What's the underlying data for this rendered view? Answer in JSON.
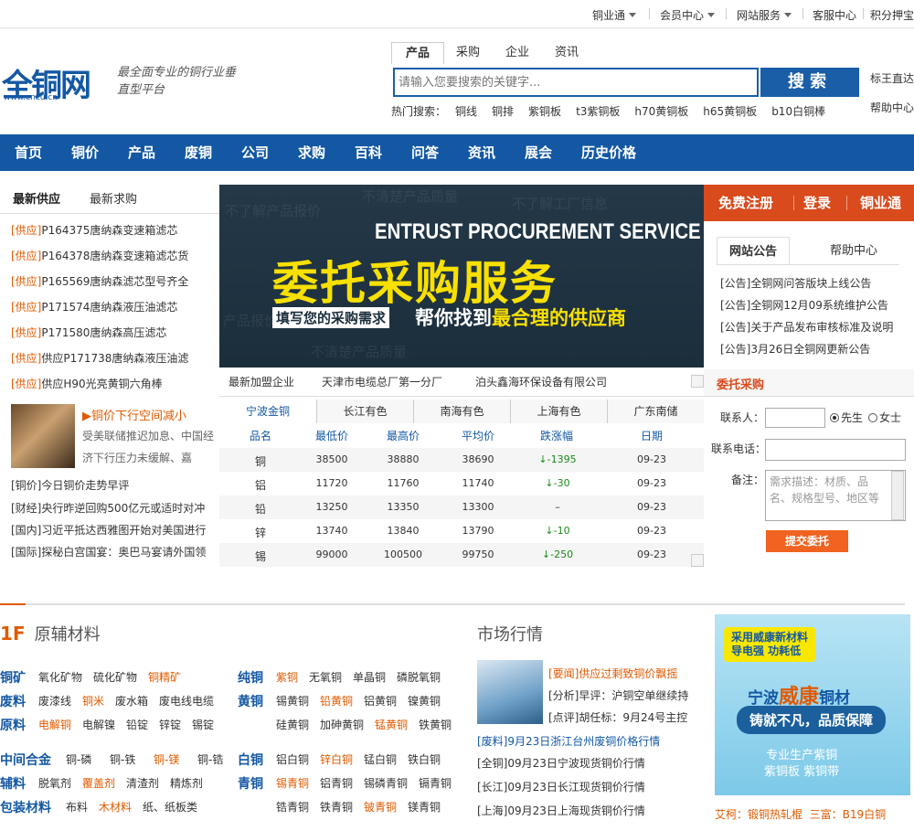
{
  "topbar": {
    "items": [
      {
        "label": "铜业通",
        "dropdown": true
      },
      {
        "label": "会员中心",
        "dropdown": true
      },
      {
        "label": "网站服务",
        "dropdown": true
      },
      {
        "label": "客服中心",
        "dropdown": false
      },
      {
        "label": "积分押宝",
        "dropdown": false
      }
    ]
  },
  "header": {
    "logo_text": "全铜网",
    "logo_url": "www.cncu.cn",
    "slogan": "最全面专业的铜行业垂直型平台",
    "search_tabs": [
      "产品",
      "采购",
      "企业",
      "资讯"
    ],
    "search_placeholder": "请输入您要搜索的关键字...",
    "search_button": "搜索",
    "hot_label": "热门搜索：",
    "hot_terms": [
      "铜线",
      "铜排",
      "紫铜板",
      "t3紫铜板",
      "h70黄铜板",
      "h65黄铜板",
      "b10白铜棒"
    ],
    "right_links": [
      "标王直达",
      "帮助中心"
    ]
  },
  "nav": [
    "首页",
    "铜价",
    "产品",
    "废铜",
    "公司",
    "求购",
    "百科",
    "问答",
    "资讯",
    "展会",
    "历史价格"
  ],
  "supply": {
    "tabs": [
      "最新供应",
      "最新求购"
    ],
    "items": [
      {
        "tag": "[供应]",
        "text": "P164375唐纳森变速箱滤芯"
      },
      {
        "tag": "[供应]",
        "text": "P164378唐纳森变速箱滤芯货"
      },
      {
        "tag": "[供应]",
        "text": "P165569唐纳森滤芯型号齐全"
      },
      {
        "tag": "[供应]",
        "text": "P171574唐纳森液压油滤芯"
      },
      {
        "tag": "[供应]",
        "text": "P171580唐纳森高压滤芯"
      },
      {
        "tag": "[供应]",
        "text": "供应P171738唐纳森液压油滤"
      },
      {
        "tag": "[供应]",
        "text": "供应H90光亮黄铜六角棒"
      }
    ]
  },
  "news": {
    "headline": "▶铜价下行空间减小",
    "summary_1": "受美联储推迟加息、中国经",
    "summary_2": "济下行压力未缓解、嘉",
    "items": [
      "[铜价]今日铜价走势早评",
      "[财经]央行昨逆回购500亿元或适时对冲",
      "[国内]习近平抵达西雅图开始对美国进行",
      "[国际]探秘白宫国宴：奥巴马宴请外国领"
    ]
  },
  "banner": {
    "en_title": "ENTRUST PROCUREMENT SERVICE",
    "cn_title": "委托采购服务",
    "sub_box": "填写您的采购需求",
    "sub_text_a": "帮你找到",
    "sub_text_b": "最合理的供应商",
    "watermarks": [
      "不了解产品报价",
      "不清楚产品质量",
      "不了解工厂信息",
      "产品报价",
      "不清楚产品质量"
    ]
  },
  "new_members": {
    "label": "最新加盟企业",
    "companies": [
      "天津市电缆总厂第一分厂",
      "泊头鑫海环保设备有限公司"
    ]
  },
  "prices": {
    "tabs": [
      "宁波金铜",
      "长江有色",
      "南海有色",
      "上海有色",
      "广东南储"
    ],
    "headers": [
      "品名",
      "最低价",
      "最高价",
      "平均价",
      "跌涨幅",
      "日期"
    ],
    "rows": [
      {
        "name": "铜",
        "low": "38500",
        "high": "38880",
        "avg": "38690",
        "change": "↓-1395",
        "date": "09-23"
      },
      {
        "name": "铝",
        "low": "11720",
        "high": "11760",
        "avg": "11740",
        "change": "↓-30",
        "date": "09-23"
      },
      {
        "name": "铅",
        "low": "13250",
        "high": "13350",
        "avg": "13300",
        "change": "–",
        "date": "09-23"
      },
      {
        "name": "锌",
        "low": "13740",
        "high": "13840",
        "avg": "13790",
        "change": "↓-10",
        "date": "09-23"
      },
      {
        "name": "锡",
        "low": "99000",
        "high": "100500",
        "avg": "99750",
        "change": "↓-250",
        "date": "09-23"
      }
    ]
  },
  "auth": [
    "免费注册",
    "登录",
    "铜业通"
  ],
  "notice": {
    "tabs": [
      "网站公告",
      "帮助中心"
    ],
    "items": [
      "[公告]全铜网问答版块上线公告",
      "[公告]全铜网12月09系统维护公告",
      "[公告]关于产品发布审核标准及说明",
      "[公告]3月26日全铜网更新公告"
    ]
  },
  "entrust": {
    "title": "委托采购",
    "contact_label": "联系人：",
    "gender_male": "先生",
    "gender_female": "女士",
    "phone_label": "联系电话：",
    "note_label": "备注：",
    "note_placeholder": "需求描述：材质、品名、规格型号、地区等",
    "submit": "提交委托"
  },
  "floor": {
    "num": "1F",
    "title": "原辅材料",
    "groups": [
      {
        "cat": "铜矿",
        "items": [
          {
            "t": "氧化矿物",
            "hl": false
          },
          {
            "t": "硫化矿物",
            "hl": false
          },
          {
            "t": "铜精矿",
            "hl": true
          }
        ]
      },
      {
        "cat": "废料",
        "items": [
          {
            "t": "废漆线",
            "hl": false
          },
          {
            "t": "铜米",
            "hl": true
          },
          {
            "t": "废水箱",
            "hl": false
          },
          {
            "t": "废电线电缆",
            "hl": false
          }
        ]
      },
      {
        "cat": "原料",
        "items": [
          {
            "t": "电解铜",
            "hl": true
          },
          {
            "t": "电解镍",
            "hl": false
          },
          {
            "t": "铅锭",
            "hl": false
          },
          {
            "t": "锌锭",
            "hl": false
          },
          {
            "t": "锡锭",
            "hl": false
          }
        ]
      },
      {
        "cat": "中间合金",
        "items": [
          {
            "t": "铜-磷",
            "hl": false
          },
          {
            "t": "铜-铁",
            "hl": false
          },
          {
            "t": "铜-镁",
            "hl": true
          },
          {
            "t": "铜-锆",
            "hl": false
          }
        ]
      },
      {
        "cat": "辅料",
        "items": [
          {
            "t": "脱氧剂",
            "hl": false
          },
          {
            "t": "覆盖剂",
            "hl": true
          },
          {
            "t": "清渣剂",
            "hl": false
          },
          {
            "t": "精炼剂",
            "hl": false
          }
        ]
      },
      {
        "cat": "包装材料",
        "items": [
          {
            "t": "布料",
            "hl": false
          },
          {
            "t": "木材料",
            "hl": true
          },
          {
            "t": "纸、纸板类",
            "hl": false
          }
        ]
      }
    ],
    "groups2": [
      {
        "cat": "纯铜",
        "items": [
          {
            "t": "紫铜",
            "hl": true
          },
          {
            "t": "无氧铜",
            "hl": false
          },
          {
            "t": "单晶铜",
            "hl": false
          },
          {
            "t": "磷脱氧铜",
            "hl": false
          }
        ]
      },
      {
        "cat": "黄铜",
        "items": [
          {
            "t": "锡黄铜",
            "hl": false
          },
          {
            "t": "铅黄铜",
            "hl": true
          },
          {
            "t": "铝黄铜",
            "hl": false
          },
          {
            "t": "镍黄铜",
            "hl": false
          }
        ]
      },
      {
        "cat": "",
        "items": [
          {
            "t": "硅黄铜",
            "hl": false
          },
          {
            "t": "加砷黄铜",
            "hl": false
          },
          {
            "t": "锰黄铜",
            "hl": true
          },
          {
            "t": "铁黄铜",
            "hl": false
          }
        ]
      },
      {
        "cat": "白铜",
        "items": [
          {
            "t": "铝白铜",
            "hl": false
          },
          {
            "t": "锌白铜",
            "hl": true
          },
          {
            "t": "锰白铜",
            "hl": false
          },
          {
            "t": "铁白铜",
            "hl": false
          }
        ]
      },
      {
        "cat": "青铜",
        "items": [
          {
            "t": "锡青铜",
            "hl": true
          },
          {
            "t": "铝青铜",
            "hl": false
          },
          {
            "t": "锡磷青铜",
            "hl": false
          },
          {
            "t": "镉青铜",
            "hl": false
          }
        ]
      },
      {
        "cat": "",
        "items": [
          {
            "t": "锆青铜",
            "hl": false
          },
          {
            "t": "铁青铜",
            "hl": false
          },
          {
            "t": "铍青铜",
            "hl": true
          },
          {
            "t": "镁青铜",
            "hl": false
          }
        ]
      }
    ]
  },
  "market": {
    "title": "市场行情",
    "items": [
      {
        "tag": "[要闻]",
        "text": "供应过剩致铜价飘摇",
        "hl": true
      },
      {
        "tag": "[分析]",
        "text": "早评：沪铜空单继续持",
        "hl": false
      },
      {
        "tag": "[点评]",
        "text": "胡任标：9月24号主控",
        "hl": false
      },
      {
        "tag": "[废料]",
        "text": "9月23日浙江台州废铜价格行情",
        "hl": true
      },
      {
        "tag": "[全铜]",
        "text": "09月23日宁波现货铜价行情",
        "hl": false
      },
      {
        "tag": "[长江]",
        "text": "09月23日长江现货铜价行情",
        "hl": false
      },
      {
        "tag": "[上海]",
        "text": "09月23日上海现货铜价行情",
        "hl": false
      }
    ]
  },
  "ad": {
    "line1": "采用威康新材料",
    "line2": "导电强 功耗低",
    "brand_a": "宁波",
    "brand_b": "威康",
    "brand_c": "铜材",
    "slogan": "铸就不凡，品质保障",
    "desc1": "专业生产紫铜",
    "desc2": "紫铜板  紫铜带",
    "foot_a": "艾柯：锻铜热轧棍",
    "foot_b": "三富：B19白铜"
  },
  "colors": {
    "brand_blue": "#1458a4",
    "accent_orange": "#e05a00",
    "auth_red": "#d94a1c"
  }
}
